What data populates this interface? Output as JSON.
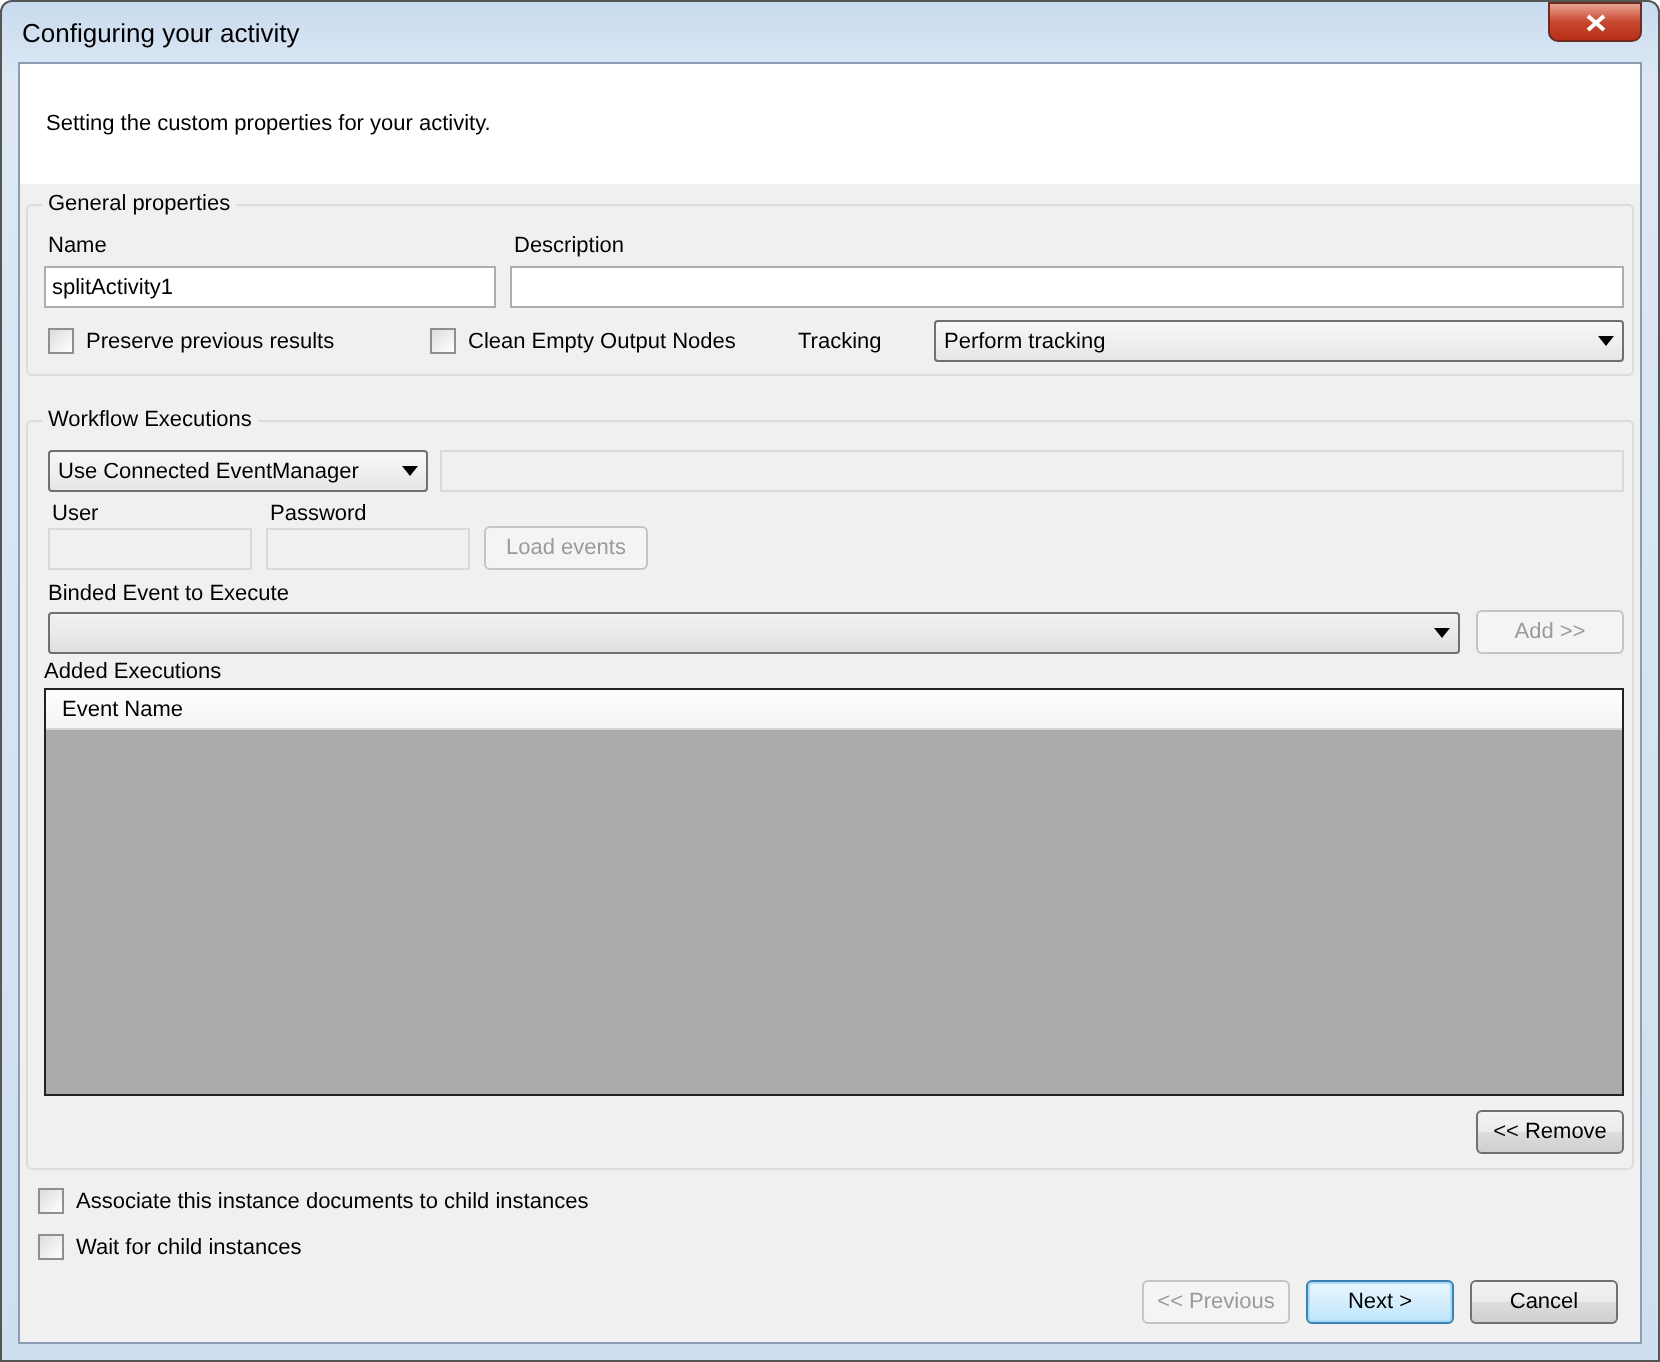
{
  "window": {
    "title": "Configuring your activity"
  },
  "header": {
    "text": "Setting the custom properties for your activity."
  },
  "general": {
    "legend": "General properties",
    "fields": [
      {
        "label": "Name",
        "value": "splitActivity1"
      },
      {
        "label": "Description"
      }
    ],
    "checkboxes": [
      {
        "label": "Preserve previous results",
        "checked": false
      },
      {
        "label": "Clean Empty Output Nodes",
        "checked": false
      }
    ],
    "tracking": {
      "label": "Tracking",
      "value": "Perform tracking"
    }
  },
  "workflow": {
    "legend": "Workflow Executions",
    "mode": {
      "value": "Use Connected EventManager"
    },
    "server_field": {
      "disabled": true
    },
    "credentials": [
      {
        "label": "User",
        "disabled": true
      },
      {
        "label": "Password",
        "disabled": true
      }
    ],
    "load_button": {
      "label": "Load events",
      "disabled": true
    },
    "binded": {
      "label": "Binded Event to Execute"
    },
    "add_button": {
      "label": "Add >>",
      "disabled": true
    },
    "added_label": "Added Executions",
    "table": {
      "columns": [
        "Event Name"
      ]
    },
    "remove_button": {
      "label": "<< Remove",
      "disabled": false
    }
  },
  "options": [
    {
      "label": "Associate this instance documents to child instances",
      "checked": false
    },
    {
      "label": "Wait for child instances",
      "checked": false
    }
  ],
  "buttons": [
    {
      "label": "<< Previous",
      "disabled": true,
      "default": false
    },
    {
      "label": "Next >",
      "disabled": false,
      "default": true
    },
    {
      "label": "Cancel",
      "disabled": false,
      "default": false
    }
  ]
}
